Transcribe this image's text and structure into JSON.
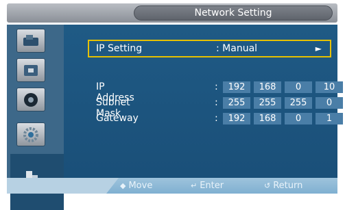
{
  "window": {
    "title": "Network Setting"
  },
  "sidebar": {
    "items": [
      {
        "icon": "picture-icon"
      },
      {
        "icon": "sound-icon"
      },
      {
        "icon": "setup-icon"
      },
      {
        "icon": "network-settings-icon"
      },
      {
        "icon": "multi-screen-icon"
      }
    ]
  },
  "menu": {
    "ip_setting": {
      "label": "IP Setting",
      "value": ": Manual",
      "arrow": "►"
    },
    "ip_address": {
      "label": "IP Address",
      "colon": ":",
      "octets": [
        "192",
        "168",
        "0",
        "10"
      ]
    },
    "subnet_mask": {
      "label": "Subnet Mask",
      "colon": ":",
      "octets": [
        "255",
        "255",
        "255",
        "0"
      ]
    },
    "gateway": {
      "label": "Gateway",
      "colon": ":",
      "octets": [
        "192",
        "168",
        "0",
        "1"
      ]
    }
  },
  "footer": {
    "move": {
      "icon": "◆",
      "label": "Move"
    },
    "enter": {
      "icon": "↵",
      "label": "Enter"
    },
    "return": {
      "icon": "↺",
      "label": "Return"
    }
  },
  "colors": {
    "panel": "#1f5a85",
    "highlight_border": "#e6c100",
    "octet_bg": "#4a7ea7",
    "sidebar": "#3d6889"
  }
}
